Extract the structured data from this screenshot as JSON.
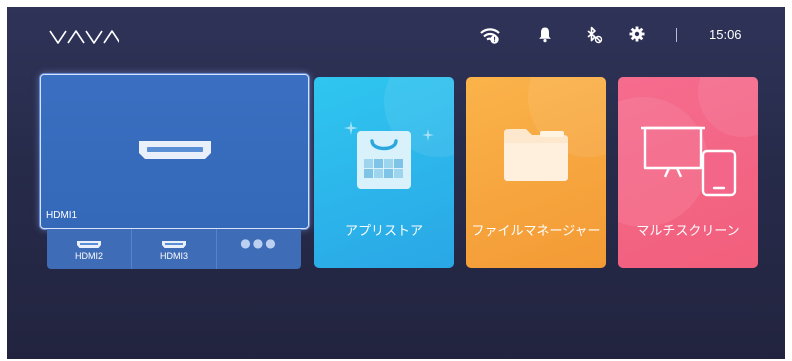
{
  "header": {
    "brand": "VAVA",
    "clock": "15:06",
    "status_icons": [
      "wifi-alert-icon",
      "bell-icon",
      "bluetooth-off-icon",
      "gear-icon"
    ]
  },
  "inputs": {
    "selected": {
      "label": "HDMI1",
      "icon": "hdmi-port-icon"
    },
    "others": [
      {
        "label": "HDMI2",
        "icon": "hdmi-port-icon"
      },
      {
        "label": "HDMI3",
        "icon": "hdmi-port-icon"
      },
      {
        "label": "",
        "icon": "more-dots-icon"
      }
    ]
  },
  "apps": [
    {
      "label": "アプリストア",
      "icon": "shopping-bag-icon",
      "color": "#2bb5ea"
    },
    {
      "label": "ファイルマネージャー",
      "icon": "folder-icon",
      "color": "#f6a33c"
    },
    {
      "label": "マルチスクリーン",
      "icon": "screen-tablet-icon",
      "color": "#f3668a"
    }
  ],
  "colors": {
    "background": "#272b4a",
    "hdmi_tile": "#3a6fc1"
  }
}
